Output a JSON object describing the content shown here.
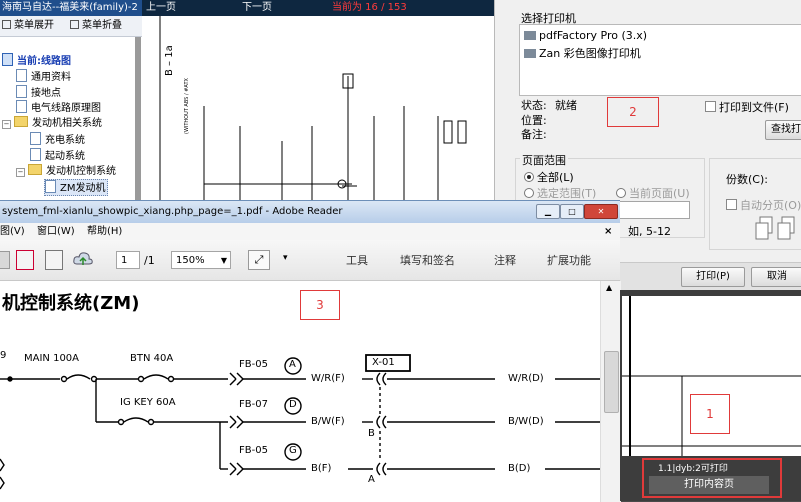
{
  "tree": {
    "title": "海南马自达--福美来(family)-2",
    "menu_expand": "菜单展开",
    "menu_collapse": "菜单折叠",
    "current": "当前:线路图",
    "items": [
      {
        "label": "通用资料"
      },
      {
        "label": "接地点"
      },
      {
        "label": "电气线路原理图"
      },
      {
        "label": "发动机相关系统"
      },
      {
        "label": "充电系统"
      },
      {
        "label": "起动系统"
      },
      {
        "label": "发动机控制系统"
      },
      {
        "label": "ZM发动机"
      }
    ]
  },
  "nav": {
    "prev": "上一页",
    "next": "下一页",
    "page_status": "当前为 16 / 153"
  },
  "print_dialog": {
    "select_printer_label": "选择打印机",
    "printers": [
      "pdfFactory Pro (3.x)",
      "Zan 彩色图像打印机"
    ],
    "status_label": "状态:",
    "status_value": "就绪",
    "location_label": "位置:",
    "note_label": "备注:",
    "print_to_file": "打印到文件(F)",
    "find_printer": "查找打",
    "page_range_label": "页面范围",
    "range_all": "全部(L)",
    "range_selection": "选定范围(T)",
    "range_current": "当前页面(U)",
    "range_hint": "如, 5-12",
    "copies_label": "份数(C):",
    "collate": "自动分页(O)",
    "print_button": "打印(P)",
    "cancel_button": "取消"
  },
  "reader": {
    "title": "system_fml-xianlu_showpic_xiang.php_page=_1.pdf - Adobe Reader",
    "menu": [
      "图(V)",
      "窗口(W)",
      "帮助(H)"
    ],
    "page_input": "1",
    "page_total": "/1",
    "zoom": "150%",
    "tools": "工具",
    "sign": "填写和签名",
    "comment": "注释",
    "extend": "扩展功能",
    "doc_title": "机控制系统(ZM)",
    "labels": {
      "main": "MAIN 100A",
      "btn": "BTN 40A",
      "igkey": "IG KEY 60A",
      "fb05": "FB-05",
      "fb07": "FB-07",
      "fb05b": "FB-05",
      "circ_a": "A",
      "circ_d": "D",
      "circ_g": "G",
      "x01": "X-01",
      "wrf": "W/R(F)",
      "bwf": "B/W(F)",
      "bf": "B(F)",
      "wrd": "W/R(D)",
      "bwd": "B/W(D)",
      "bd": "B(D)",
      "b_letter": "B",
      "a_letter": "A",
      "left9": "9"
    }
  },
  "preview": {
    "caption": "1.1|dyb:2可打印",
    "print_content_button": "打印内容页"
  },
  "annotations": {
    "box1": "1",
    "box2": "2",
    "box3": "3"
  },
  "background_doc": {
    "label_b1a": "B – 1a",
    "label_atx": "(WITHOUT ABS / #ATX"
  }
}
